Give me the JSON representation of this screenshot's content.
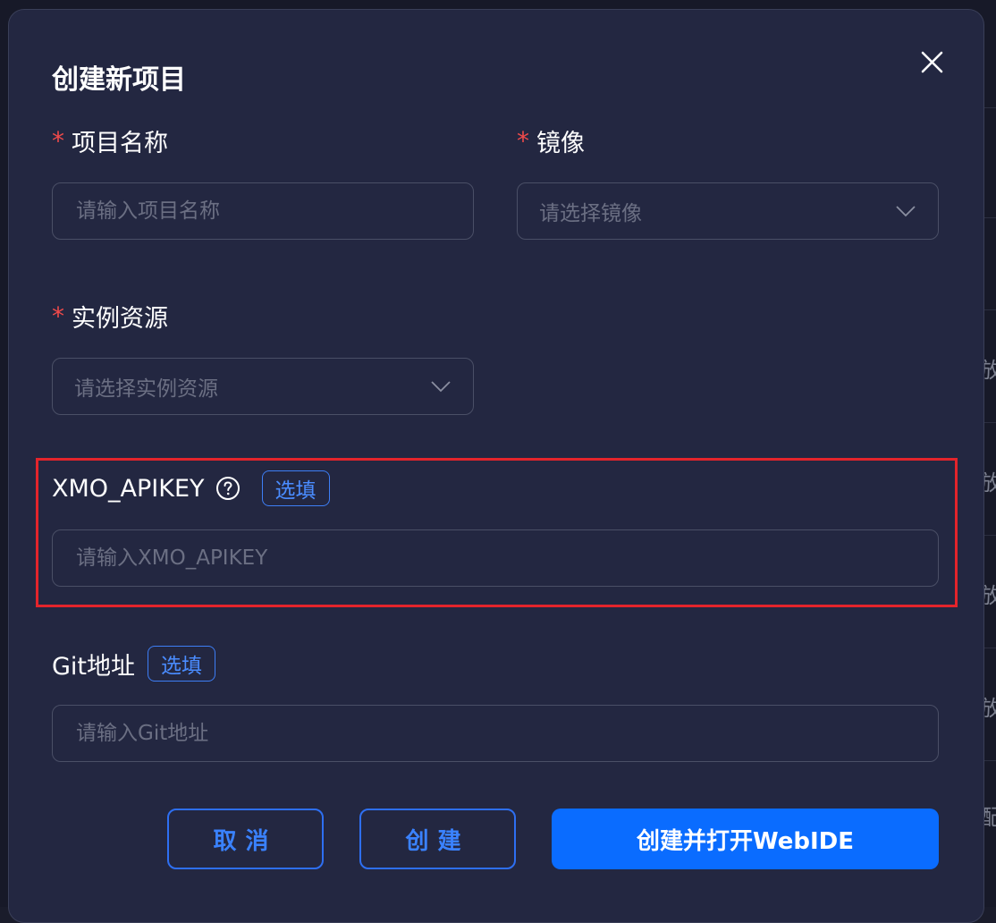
{
  "modal": {
    "title": "创建新项目"
  },
  "form": {
    "project_name": {
      "label": "项目名称",
      "required_mark": "*",
      "placeholder": "请输入项目名称",
      "value": ""
    },
    "image": {
      "label": "镜像",
      "required_mark": "*",
      "placeholder": "请选择镜像"
    },
    "instance": {
      "label": "实例资源",
      "required_mark": "*",
      "placeholder": "请选择实例资源"
    },
    "apikey": {
      "label": "XMO_APIKEY",
      "optional_tag": "选填",
      "placeholder": "请输入XMO_APIKEY",
      "value": ""
    },
    "git": {
      "label": "Git地址",
      "optional_tag": "选填",
      "placeholder": "请输入Git地址",
      "value": ""
    }
  },
  "buttons": {
    "cancel": "取消",
    "create": "创建",
    "create_open": "创建并打开WebIDE"
  },
  "background": {
    "row_chars": [
      "放",
      "放",
      "放",
      "放",
      "配"
    ]
  },
  "colors": {
    "modal_bg": "#232741",
    "accent": "#0a6cff",
    "required": "#f04a4a",
    "highlight": "#e3242b"
  }
}
